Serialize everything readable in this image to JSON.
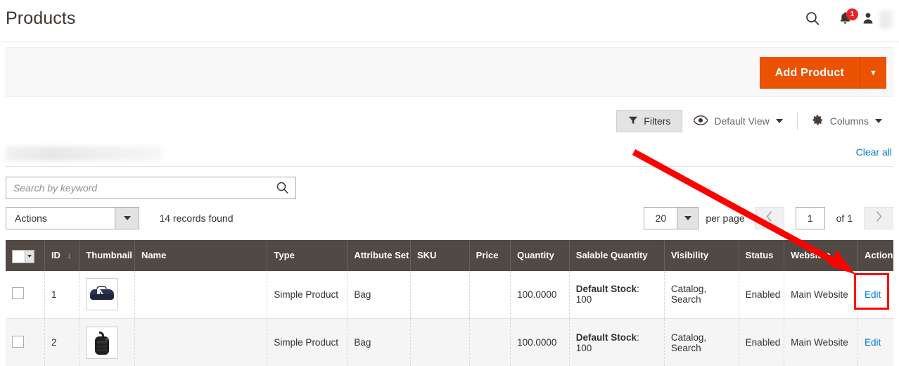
{
  "header": {
    "title": "Products",
    "search_icon": "search-icon",
    "notifications_icon": "bell-icon",
    "notifications_count": "1",
    "user_icon": "user-icon",
    "user_name": ""
  },
  "page_actions": {
    "add_product_label": "Add Product",
    "add_product_toggle_icon": "chevron-down-icon"
  },
  "grid_toolbar": {
    "filters_label": "Filters",
    "filters_icon": "funnel-icon",
    "view_icon": "eye-icon",
    "view_label": "Default View",
    "columns_icon": "gear-icon",
    "columns_label": "Columns",
    "caret_icon": "caret-down-icon"
  },
  "active_filters": {
    "chip_label": "",
    "clear_all_label": "Clear all"
  },
  "search": {
    "placeholder": "Search by keyword",
    "value": "",
    "submit_icon": "search-icon"
  },
  "actions": {
    "select_label": "Actions",
    "select_caret_icon": "caret-down-icon",
    "records_found": "14 records found"
  },
  "pagination": {
    "per_page_value": "20",
    "per_page_caret_icon": "caret-down-icon",
    "per_page_label": "per page",
    "prev_icon": "chevron-left-icon",
    "next_icon": "chevron-right-icon",
    "current_page": "1",
    "of_label": "of 1"
  },
  "grid": {
    "mass_select_icon": "caret-down-icon",
    "sort_arrow": "↓",
    "columns": [
      {
        "key": "checkbox",
        "label": ""
      },
      {
        "key": "id",
        "label": "ID"
      },
      {
        "key": "thumbnail",
        "label": "Thumbnail"
      },
      {
        "key": "name",
        "label": "Name"
      },
      {
        "key": "type",
        "label": "Type"
      },
      {
        "key": "attribute_set",
        "label": "Attribute Set"
      },
      {
        "key": "sku",
        "label": "SKU"
      },
      {
        "key": "price",
        "label": "Price"
      },
      {
        "key": "quantity",
        "label": "Quantity"
      },
      {
        "key": "salable_quantity",
        "label": "Salable Quantity"
      },
      {
        "key": "visibility",
        "label": "Visibility"
      },
      {
        "key": "status",
        "label": "Status"
      },
      {
        "key": "websites",
        "label": "Websites"
      },
      {
        "key": "action",
        "label": "Action"
      }
    ],
    "rows": [
      {
        "id": "1",
        "thumbnail_icon": "duffle-bag-thumbnail",
        "name": "",
        "type": "Simple Product",
        "attribute_set": "Bag",
        "sku": "",
        "price": "",
        "quantity": "100.0000",
        "salable_stock_label": "Default Stock",
        "salable_stock_value": ": 100",
        "visibility": "Catalog, Search",
        "status": "Enabled",
        "websites": "Main Website",
        "action_label": "Edit"
      },
      {
        "id": "2",
        "thumbnail_icon": "backpack-thumbnail",
        "name": "",
        "type": "Simple Product",
        "attribute_set": "Bag",
        "sku": "",
        "price": "",
        "quantity": "100.0000",
        "salable_stock_label": "Default Stock",
        "salable_stock_value": ": 100",
        "visibility": "Catalog, Search",
        "status": "Enabled",
        "websites": "Main Website",
        "action_label": "Edit"
      }
    ]
  },
  "annotation": {
    "arrow_color": "#ff0000",
    "highlight_color": "#ff0000",
    "target": "Edit"
  },
  "colors": {
    "accent_orange": "#eb5202",
    "link_blue": "#007bdb",
    "header_row": "#514943",
    "badge_red": "#e22626"
  }
}
